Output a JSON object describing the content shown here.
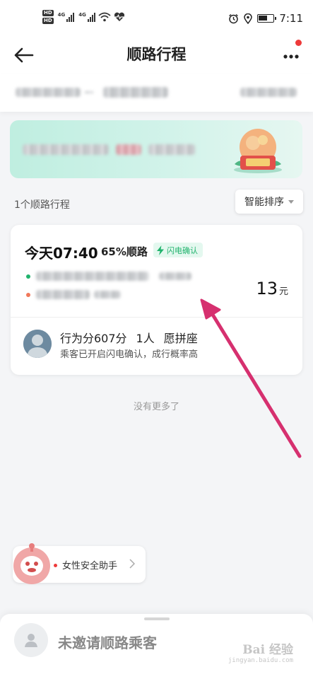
{
  "status_bar": {
    "hd_top": "HD",
    "hd_bottom": "HD",
    "network_1": "4G",
    "network_2": "4G",
    "time": "7:11"
  },
  "nav": {
    "title": "顺路行程"
  },
  "trips": {
    "count_label": "1个顺路行程",
    "sort_label": "智能排序",
    "card": {
      "time": "今天07:40",
      "match": "65%顺路",
      "flash_badge": "闪电确认",
      "price": "13",
      "price_unit": "元",
      "passenger_score": "行为分607分",
      "passenger_count": "1人",
      "carpool": "愿拼座",
      "passenger_note": "乘客已开启闪电确认，成行概率高"
    },
    "no_more": "没有更多了"
  },
  "safety": {
    "label": "女性安全助手"
  },
  "sheet": {
    "title": "未邀请顺路乘客"
  },
  "watermark": {
    "logo": "Bai 经验",
    "url": "jingyan.baidu.com"
  },
  "colors": {
    "accent_green": "#21b36d",
    "banner": "#c6efe2",
    "annotation_arrow": "#d6306f",
    "badge_red": "#ee3a3a"
  }
}
